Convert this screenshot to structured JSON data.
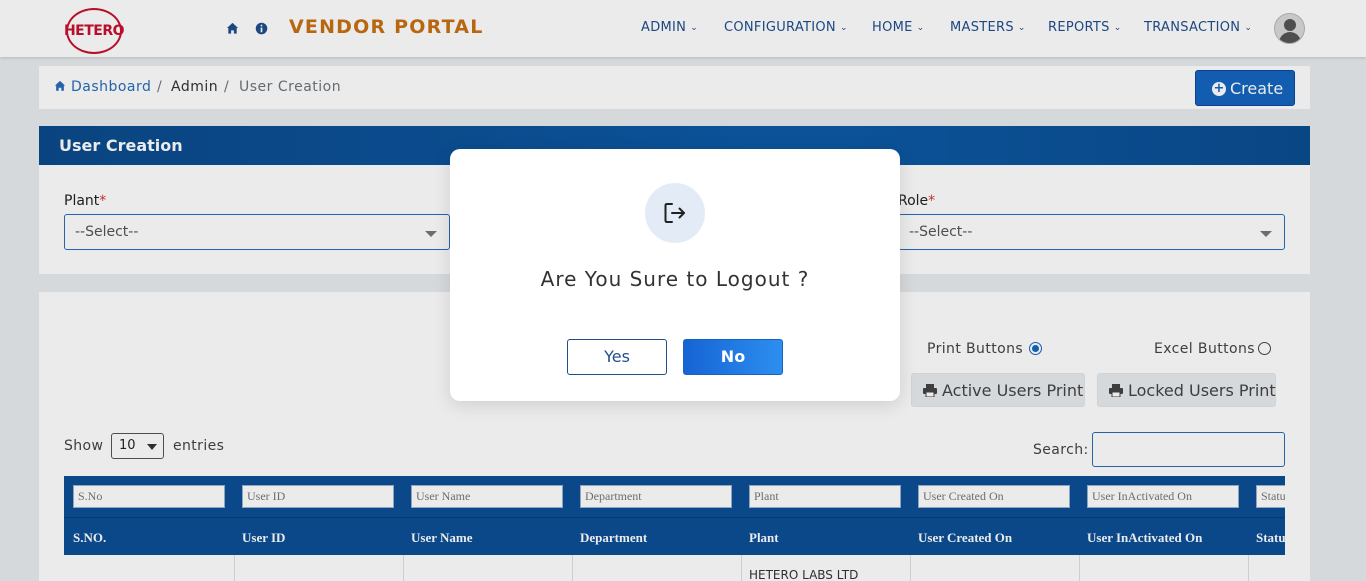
{
  "header": {
    "logo_text": "HETERO",
    "portal_title": "VENDOR PORTAL",
    "nav": [
      "ADMIN",
      "CONFIGURATION",
      "HOME",
      "MASTERS",
      "REPORTS",
      "TRANSACTION"
    ],
    "icons": [
      "home-icon",
      "info-icon",
      "user-avatar-icon"
    ],
    "colors": {
      "brand_red": "#c8102e",
      "title_orange": "#c96f12",
      "nav_blue": "#1f4e8c"
    }
  },
  "breadcrumb": {
    "dashboard": "Dashboard",
    "admin": "Admin",
    "current": "User Creation",
    "separator": "/"
  },
  "create_button": {
    "label": "Create"
  },
  "form": {
    "title": "User Creation",
    "plant_label": "Plant",
    "role_label": "Role",
    "required_mark": "*",
    "plant_value": "--Select--",
    "role_value": "--Select--"
  },
  "options": {
    "print_buttons": "Print Buttons",
    "excel_buttons": "Excel Buttons",
    "selected": "Print Buttons",
    "active_users_print": "Active Users Print",
    "locked_users_print": "Locked Users Print"
  },
  "table_controls": {
    "show": "Show",
    "entries": "entries",
    "page_length": "10",
    "search_label": "Search:"
  },
  "table": {
    "filter_placeholders": [
      "S.No",
      "User ID",
      "User Name",
      "Department",
      "Plant",
      "User Created On",
      "User InActivated On",
      "Status"
    ],
    "headers": [
      "S.NO.",
      "User ID",
      "User Name",
      "Department",
      "Plant",
      "User Created On",
      "User InActivated On",
      "Status"
    ],
    "first_row_plant": "HETERO LABS LTD"
  },
  "modal": {
    "message": "Are You Sure to Logout ?",
    "yes": "Yes",
    "no": "No",
    "icon": "logout-icon"
  }
}
